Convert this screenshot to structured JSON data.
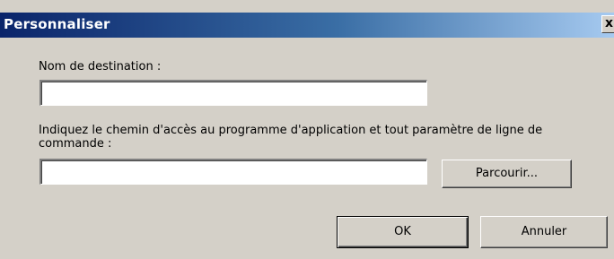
{
  "window": {
    "title": "Personnaliser",
    "close_label": "x"
  },
  "form": {
    "destination_label": "Nom de destination :",
    "destination_value": "",
    "path_label": "Indiquez le chemin d'accès au programme d'application et tout paramètre de ligne de commande :",
    "path_value": "",
    "browse_label": "Parcourir..."
  },
  "buttons": {
    "ok_label": "OK",
    "cancel_label": "Annuler"
  },
  "colors": {
    "title_gradient_start": "#0a246a",
    "title_gradient_end": "#a6caf0",
    "dialog_background": "#d4d0c8"
  }
}
